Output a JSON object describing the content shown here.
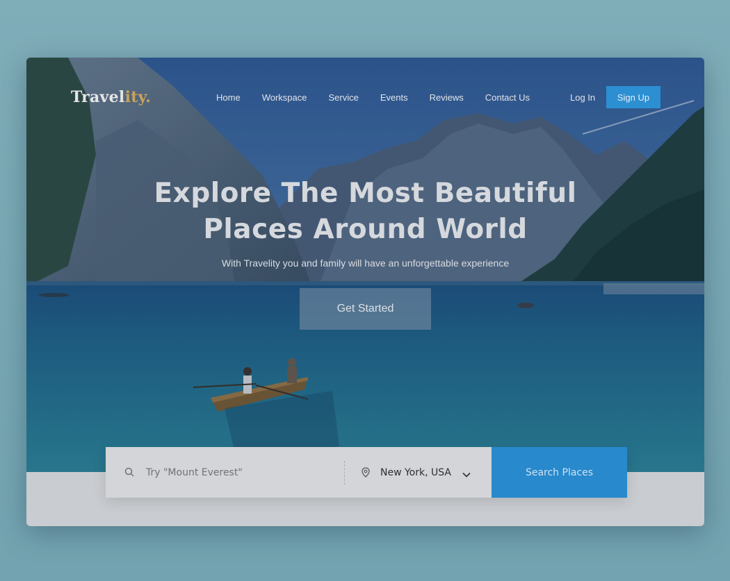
{
  "brand": {
    "logo_main": "Travel",
    "logo_accent": "ity.",
    "accent_color": "#c9a25a"
  },
  "nav": {
    "items": [
      {
        "label": "Home"
      },
      {
        "label": "Workspace"
      },
      {
        "label": "Service"
      },
      {
        "label": "Events"
      },
      {
        "label": "Reviews"
      },
      {
        "label": "Contact Us"
      }
    ],
    "login_label": "Log In",
    "signup_label": "Sign Up",
    "signup_color": "#2c8fd2"
  },
  "hero": {
    "headline_line1": "Explore The Most Beautiful",
    "headline_line2": "Places Around World",
    "subheadline": "With Travelity you and family will have an unforgettable experience",
    "cta_label": "Get Started",
    "image": "mountain-lake-rowboat"
  },
  "search": {
    "placeholder": "Try \"Mount Everest\"",
    "location_value": "New York, USA",
    "button_label": "Search Places",
    "button_color": "#2889cc",
    "icons": {
      "search": "search-icon",
      "location": "location-pin-icon",
      "dropdown": "chevron-down-icon"
    }
  }
}
